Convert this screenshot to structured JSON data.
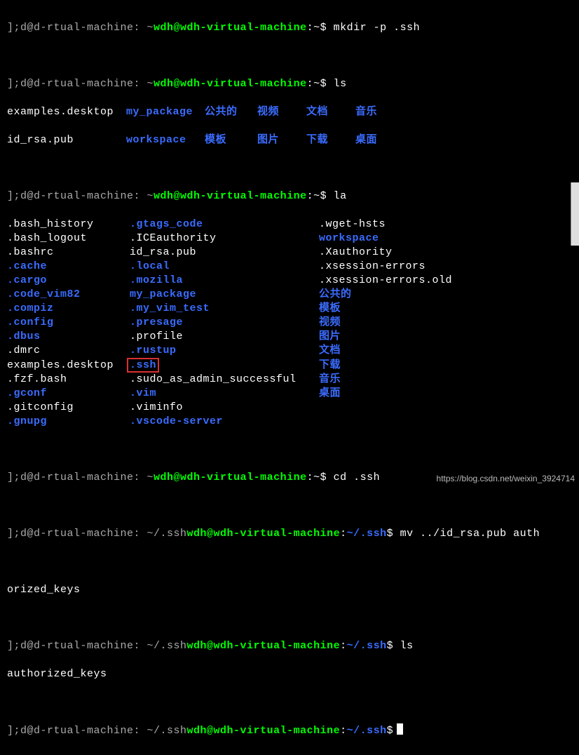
{
  "prompts": {
    "home": {
      "local": "];d@d-rtual-machine: ~",
      "remote": "wdh@wdh-virtual-machine",
      "path": ":~",
      "sep": "$ "
    },
    "ssh": {
      "local": "];d@d-rtual-machine: ~/.ssh",
      "remote": "wdh@wdh-virtual-machine",
      "path": ":~/.ssh",
      "sep": "$ "
    }
  },
  "commands": {
    "mkdir": "mkdir -p .ssh",
    "ls": "ls",
    "la": "la",
    "cd": "cd .ssh",
    "mv": "mv ../id_rsa.pub auth",
    "mv_wrap": "orized_keys",
    "ls2": "ls",
    "ls2_out": "authorized_keys"
  },
  "ls_output": {
    "r1": {
      "c1": "examples.desktop",
      "c2": "my_package",
      "c3": "公共的",
      "c4": "视频",
      "c5": "文档",
      "c6": "音乐"
    },
    "r2": {
      "c1": "id_rsa.pub",
      "c2": "workspace",
      "c3": "模板",
      "c4": "图片",
      "c5": "下载",
      "c6": "桌面"
    }
  },
  "la_output": [
    {
      "c1": ".bash_history",
      "k1": "white",
      "c2": ".gtags_code",
      "k2": "bblue",
      "c3": ".wget-hsts",
      "k3": "white"
    },
    {
      "c1": ".bash_logout",
      "k1": "white",
      "c2": ".ICEauthority",
      "k2": "white",
      "c3": "workspace",
      "k3": "bblue"
    },
    {
      "c1": ".bashrc",
      "k1": "white",
      "c2": "id_rsa.pub",
      "k2": "white",
      "c3": ".Xauthority",
      "k3": "white"
    },
    {
      "c1": ".cache",
      "k1": "bblue",
      "c2": ".local",
      "k2": "bblue",
      "c3": ".xsession-errors",
      "k3": "white"
    },
    {
      "c1": ".cargo",
      "k1": "bblue",
      "c2": ".mozilla",
      "k2": "bblue",
      "c3": ".xsession-errors.old",
      "k3": "white"
    },
    {
      "c1": ".code_vim82",
      "k1": "bblue",
      "c2": "my_package",
      "k2": "bblue",
      "c3": "公共的",
      "k3": "bblue"
    },
    {
      "c1": ".compiz",
      "k1": "bblue",
      "c2": ".my_vim_test",
      "k2": "bblue",
      "c3": "模板",
      "k3": "bblue"
    },
    {
      "c1": ".config",
      "k1": "bblue",
      "c2": ".presage",
      "k2": "bblue",
      "c3": "视频",
      "k3": "bblue"
    },
    {
      "c1": ".dbus",
      "k1": "bblue",
      "c2": ".profile",
      "k2": "white",
      "c3": "图片",
      "k3": "bblue"
    },
    {
      "c1": ".dmrc",
      "k1": "white",
      "c2": ".rustup",
      "k2": "bblue",
      "c3": "文档",
      "k3": "bblue"
    },
    {
      "c1": "examples.desktop",
      "k1": "white",
      "c2": ".ssh",
      "k2": "box",
      "c3": "下载",
      "k3": "bblue"
    },
    {
      "c1": ".fzf.bash",
      "k1": "white",
      "c2": ".sudo_as_admin_successful",
      "k2": "white",
      "c3": "音乐",
      "k3": "bblue"
    },
    {
      "c1": ".gconf",
      "k1": "bblue",
      "c2": ".vim",
      "k2": "bblue",
      "c3": "桌面",
      "k3": "bblue"
    },
    {
      "c1": ".gitconfig",
      "k1": "white",
      "c2": ".viminfo",
      "k2": "white",
      "c3": "",
      "k3": "white"
    },
    {
      "c1": ".gnupg",
      "k1": "bblue",
      "c2": ".vscode-server",
      "k2": "bblue",
      "c3": "",
      "k3": "white"
    }
  ],
  "watermark": "https://blog.csdn.net/weixin_3924714"
}
